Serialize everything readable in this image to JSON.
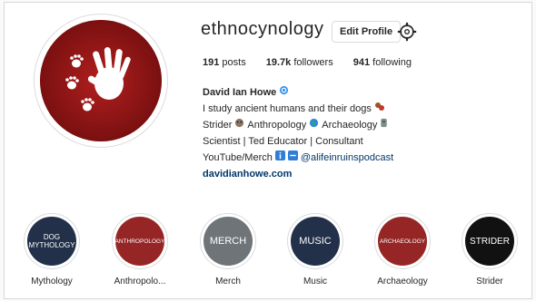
{
  "profile": {
    "username": "ethnocynology",
    "edit_label": "Edit Profile",
    "settings_icon": "gear-icon",
    "avatar_icon": "handprint-paws-logo",
    "stats": {
      "posts_value": "191",
      "posts_label": "posts",
      "followers_value": "19.7k",
      "followers_label": "followers",
      "following_value": "941",
      "following_label": "following"
    },
    "bio": {
      "name": "David Ian Howe",
      "line1": "I study ancient humans and their dogs",
      "line2_a": "Strider",
      "line2_b": "Anthropology",
      "line2_c": "Archaeology",
      "line3": "Scientist | Ted Educator | Consultant",
      "line4_a": "YouTube/Merch",
      "line4_handle": "@alifeinruinspodcast",
      "website": "davidianhowe.com"
    }
  },
  "highlights": [
    {
      "cover_text": "DOG MYTHOLOGY",
      "label": "Mythology",
      "color": "#23304a"
    },
    {
      "cover_text": "ANTHROPOLOGY",
      "label": "Anthropolo...",
      "color": "#962626"
    },
    {
      "cover_text": "MERCH",
      "label": "Merch",
      "color": "#6f7478"
    },
    {
      "cover_text": "MUSIC",
      "label": "Music",
      "color": "#23304a"
    },
    {
      "cover_text": "ARCHAEOLOGY",
      "label": "Archaeology",
      "color": "#962626"
    },
    {
      "cover_text": "STRIDER",
      "label": "Strider",
      "color": "#111111"
    }
  ],
  "colors": {
    "link": "#00376b",
    "brand_red": "#962626",
    "verified_blue": "#3897f0"
  }
}
